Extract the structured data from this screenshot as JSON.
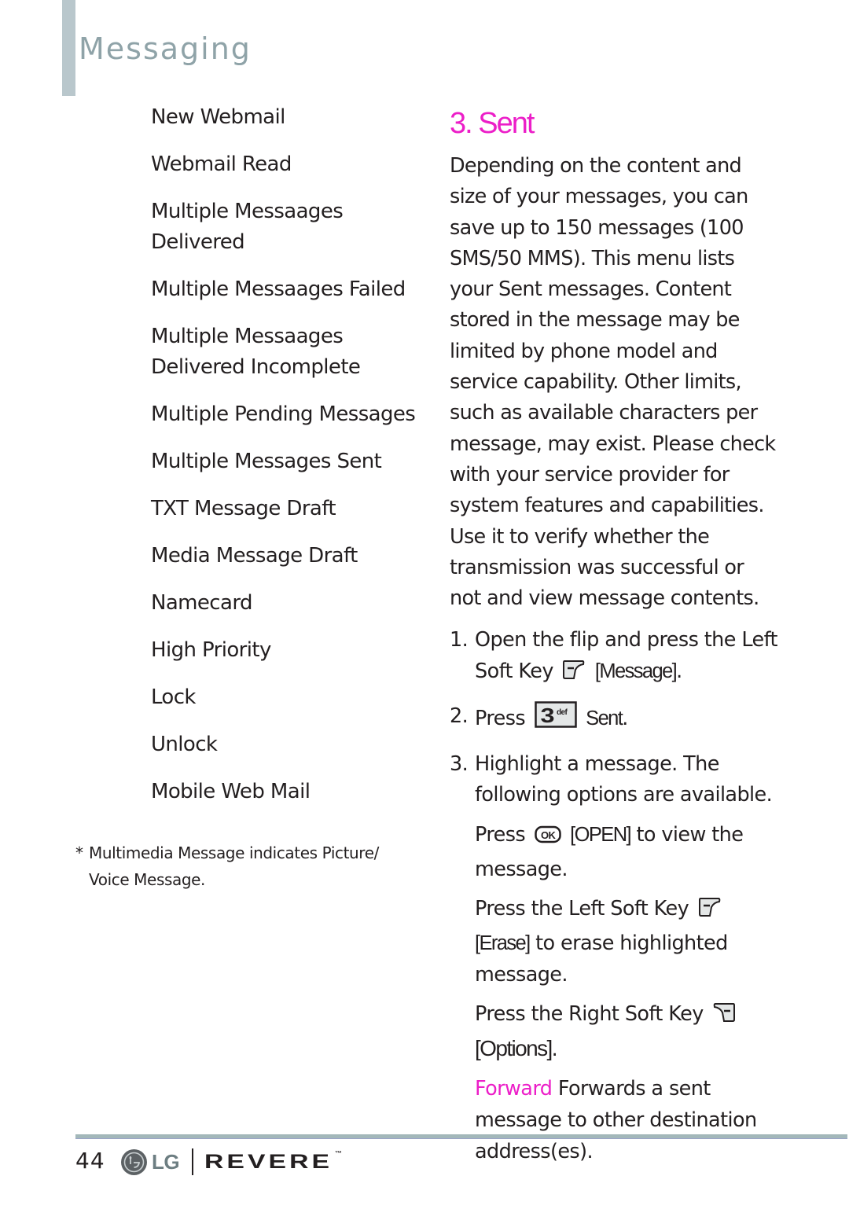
{
  "header": {
    "title": "Messaging"
  },
  "left_menu": {
    "items": [
      "New Webmail",
      "Webmail Read",
      "Multiple Messaages Delivered",
      "Multiple Messaages Failed",
      "Multiple Messaages Delivered Incomplete",
      "Multiple Pending Messages",
      "Multiple Messages Sent",
      "TXT Message Draft",
      "Media Message Draft",
      "Namecard",
      "High Priority",
      "Lock",
      "Unlock",
      "Mobile Web Mail"
    ],
    "item_lines": {
      "i2a": "Multiple Messaages",
      "i2b": "Delivered",
      "i4a": "Multiple Messaages",
      "i4b": "Delivered Incomplete"
    },
    "footnote": {
      "marker": "*",
      "line1": "Multimedia Message indicates Picture/",
      "line2": "Voice Message."
    }
  },
  "section": {
    "title": "3. Sent",
    "intro": "Depending on the content and size of your messages, you can save up to 150 messages (100 SMS/50 MMS). This menu lists your Sent messages. Content stored in the message may be limited by phone model and service capability. Other limits, such as available characters per message, may exist. Please check with your service provider for system features and capabilities. Use it to verify whether the transmission was successful or not and view message contents.",
    "steps": [
      {
        "num": "1.",
        "text_a": "Open the flip and press the Left Soft Key",
        "icon": "left-soft-key-icon",
        "key_label": "[Message]",
        "text_b": "."
      },
      {
        "num": "2.",
        "text_a": "Press",
        "icon": "key-3-def-icon",
        "key_label": "Sent",
        "text_b": "."
      },
      {
        "num": "3.",
        "text_a": "Highlight a message. The following options are available."
      }
    ],
    "options": {
      "open": {
        "pre": "Press",
        "icon": "ok-key-icon",
        "key_label": "[OPEN]",
        "post": "to view the message."
      },
      "erase": {
        "pre": "Press the Left Soft Key",
        "icon": "left-soft-key-icon",
        "key_label": "[Erase]",
        "post": "to erase highlighted message."
      },
      "options": {
        "pre": "Press the Right Soft Key",
        "icon": "right-soft-key-icon",
        "key_label": "[Options]",
        "post": "."
      },
      "forward": {
        "term": "Forward",
        "desc": "Forwards a sent message to other destination address(es)."
      }
    },
    "key_3_glyph": "3",
    "key_3_letters": "def",
    "ok_glyph": "OK"
  },
  "footer": {
    "page_number": "44",
    "brand": "LG",
    "product": "REVERE",
    "trademark": "™"
  },
  "colors": {
    "accent_pink": "#ec1ec8",
    "header_gray": "#8fa3a8",
    "rule": "#a3b8ba"
  }
}
